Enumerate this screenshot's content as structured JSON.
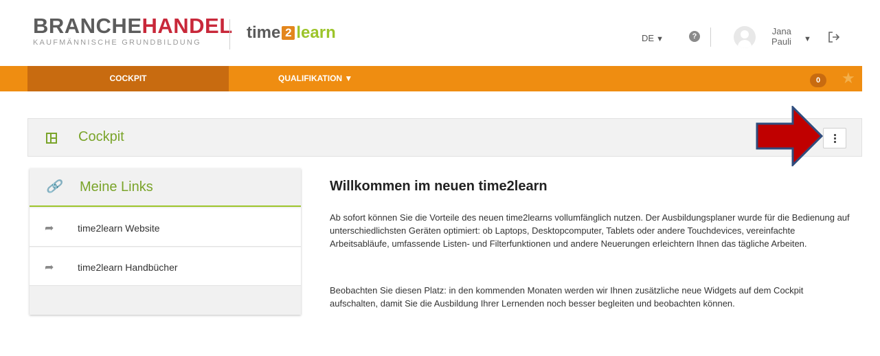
{
  "header": {
    "logo_main_part1": "BRANCHE",
    "logo_main_part2": "HANDEL",
    "logo_sub": "KAUFMÄNNISCHE GRUNDBILDUNG",
    "app_time": "time",
    "app_two": "2",
    "app_learn": "learn",
    "language": "DE",
    "help_symbol": "?",
    "user_first": "Jana",
    "user_last": "Pauli"
  },
  "nav": {
    "tabs": [
      {
        "label": "COCKPIT",
        "active": true
      },
      {
        "label": "QUALIFIKATION ▼",
        "active": false
      }
    ],
    "badge_count": "0",
    "star_icon": "star-icon"
  },
  "cockpit": {
    "title": "Cockpit",
    "menu_icon": "kebab-menu-icon"
  },
  "links": {
    "title": "Meine Links",
    "items": [
      {
        "label": "time2learn Website"
      },
      {
        "label": "time2learn Handbücher"
      }
    ]
  },
  "welcome": {
    "title": "Willkommen im neuen time2learn",
    "para1": "Ab sofort können Sie die Vorteile des neuen time2learns vollumfänglich nutzen. Der Ausbildungsplaner wurde für die Bedienung auf unterschiedlichsten Geräten optimiert: ob Laptops, Desktopcomputer, Tablets oder andere Touchdevices, vereinfachte Arbeitsabläufe, umfassende Listen- und Filterfunktionen und andere Neuerungen erleichtern Ihnen das tägliche Arbeiten.",
    "para2": "Beobachten Sie diesen Platz: in den kommenden Monaten werden wir Ihnen zusätzliche neue Widgets auf dem Cockpit aufschalten, damit Sie die Ausbildung Ihrer Lernenden noch besser begleiten und beobachten können."
  },
  "colors": {
    "orange": "#ef8d11",
    "dark_orange": "#c86b10",
    "green": "#7aa42a",
    "red_brand": "#c8283a",
    "arrow_red": "#c00000",
    "arrow_border": "#2f4d7e"
  }
}
